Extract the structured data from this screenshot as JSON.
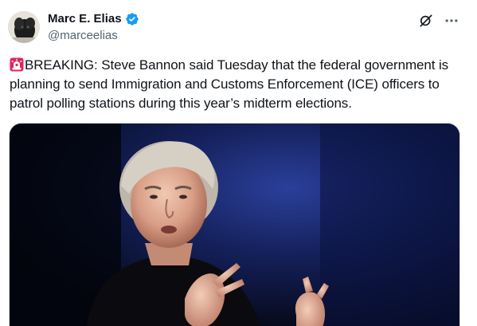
{
  "author": {
    "display_name": "Marc E. Elias",
    "handle": "@marceelias",
    "verified": true,
    "verified_color": "#1d9bf0"
  },
  "icons": {
    "grok": "grok-icon",
    "more": "more-horizontal-icon",
    "alarm_emoji": "rotating-light-icon"
  },
  "tweet": {
    "text": "BREAKING: Steve Bannon said Tuesday that the federal government is planning to send Immigration and Customs Enforcement (ICE) officers to patrol polling stations during this year’s midterm elections."
  },
  "colors": {
    "text_primary": "#0f1419",
    "text_secondary": "#536471",
    "border": "#cfd9de"
  }
}
